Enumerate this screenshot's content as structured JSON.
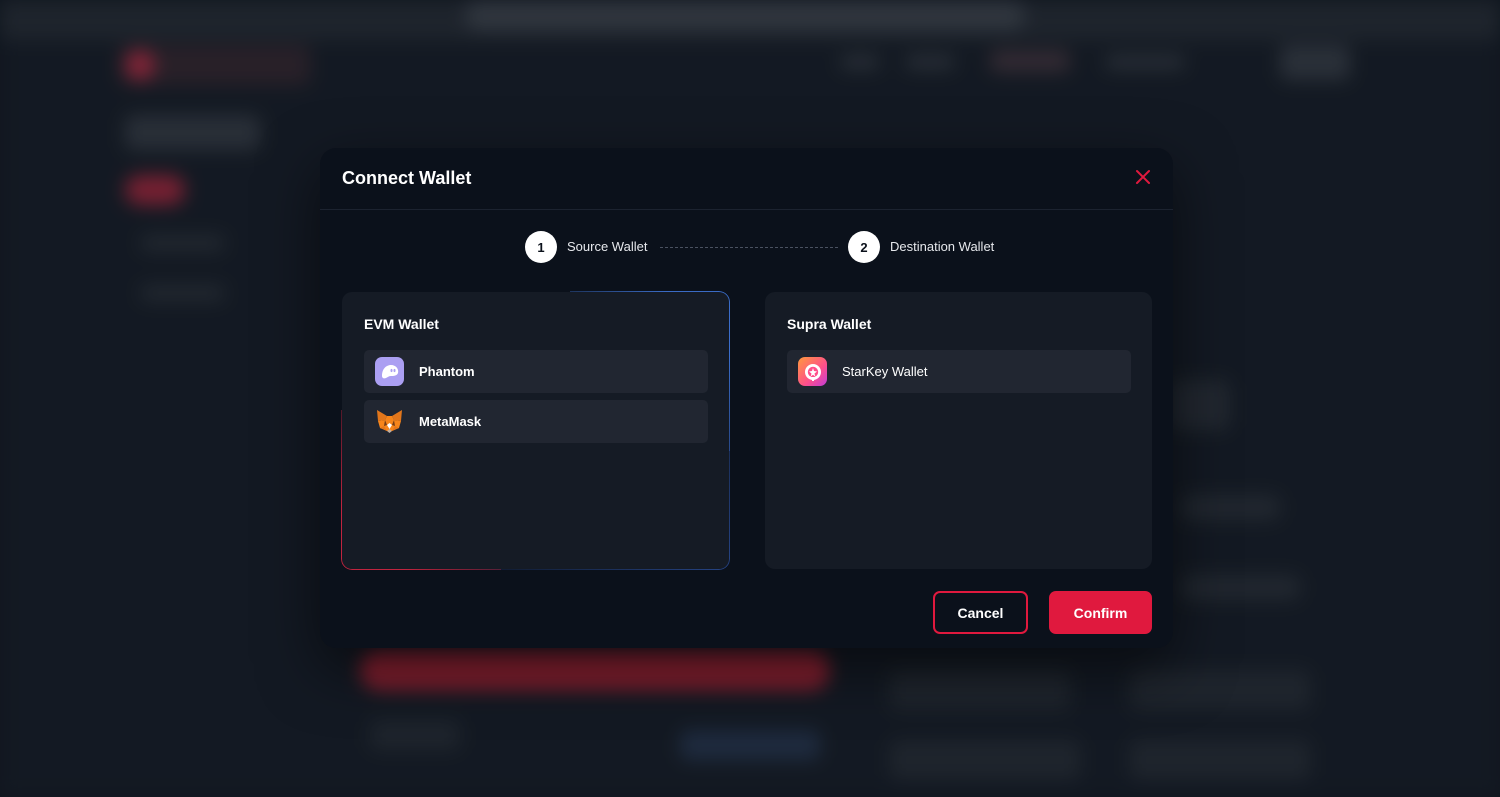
{
  "modal": {
    "title": "Connect Wallet",
    "close_icon": "close-icon"
  },
  "stepper": {
    "steps": [
      {
        "number": "1",
        "label": "Source Wallet"
      },
      {
        "number": "2",
        "label": "Destination Wallet"
      }
    ]
  },
  "panels": {
    "evm": {
      "title": "EVM Wallet",
      "wallets": [
        {
          "name": "Phantom",
          "icon": "phantom-ghost-icon"
        },
        {
          "name": "MetaMask",
          "icon": "metamask-fox-icon"
        }
      ]
    },
    "supra": {
      "title": "Supra Wallet",
      "wallets": [
        {
          "name": "StarKey Wallet",
          "icon": "starkey-icon"
        }
      ]
    }
  },
  "actions": {
    "cancel_label": "Cancel",
    "confirm_label": "Confirm"
  },
  "colors": {
    "accent": "#e0193e",
    "modal_bg": "#0b111b",
    "panel_bg": "#151b25",
    "item_bg": "#212631"
  }
}
